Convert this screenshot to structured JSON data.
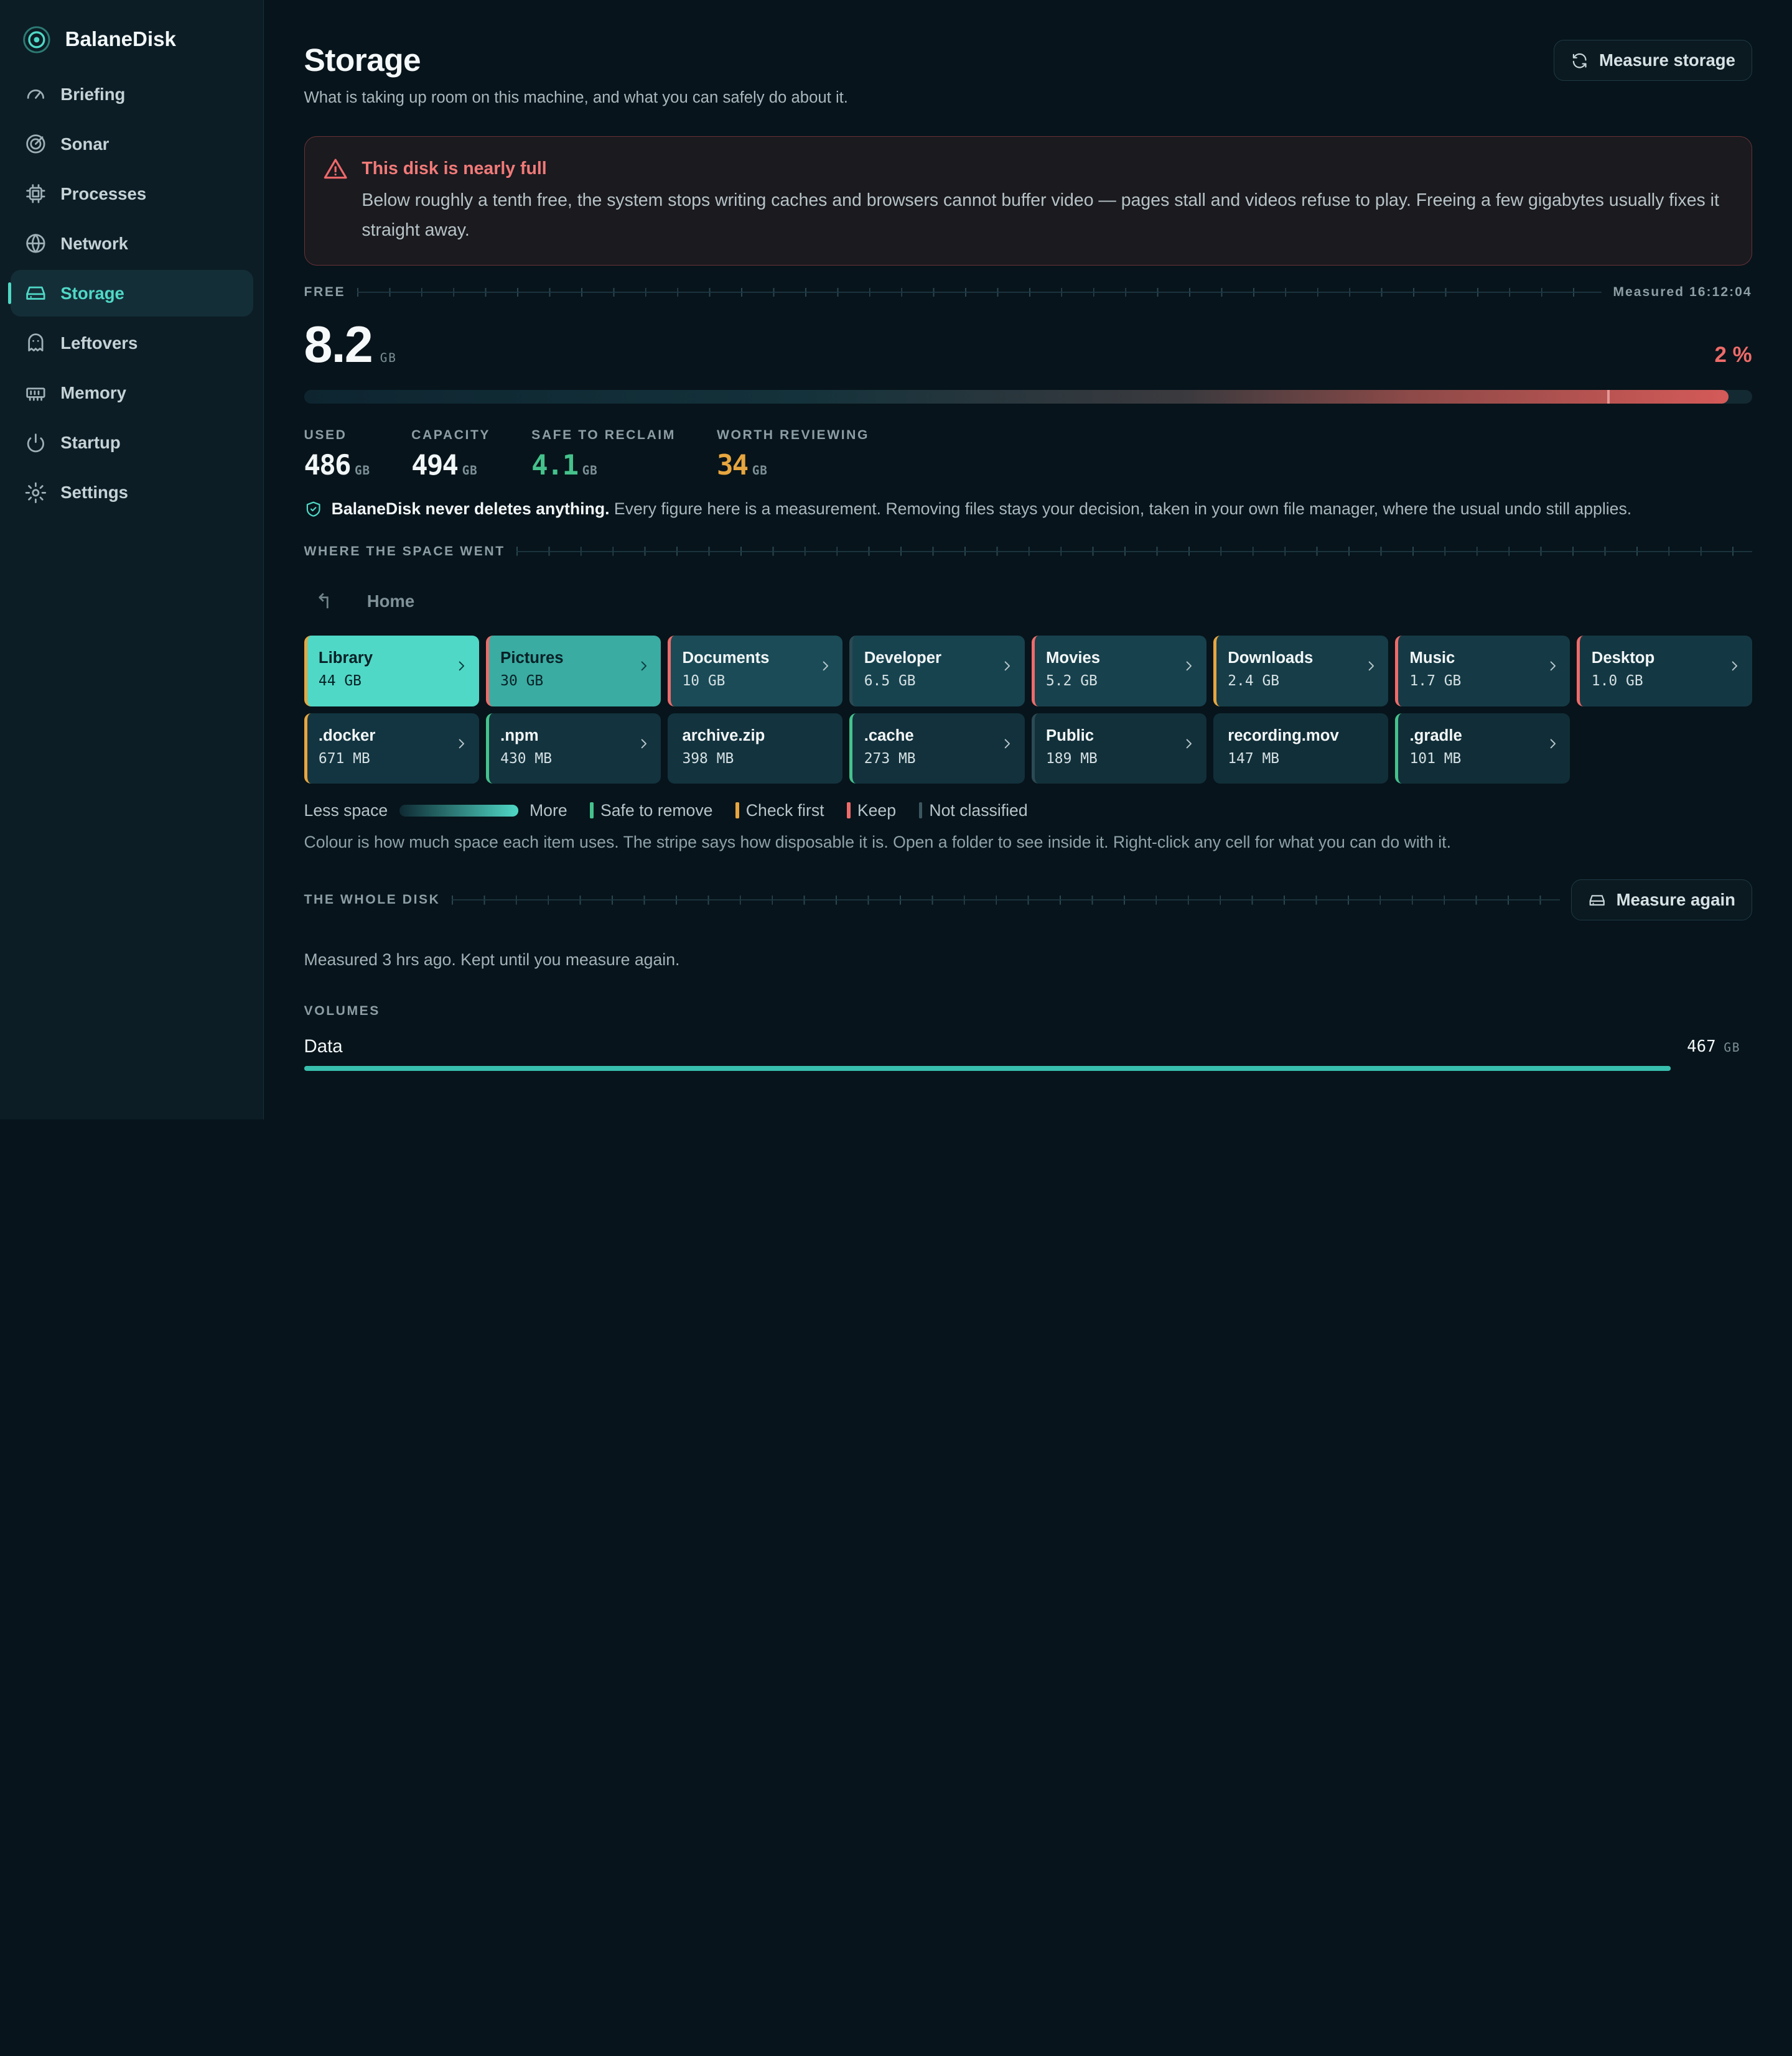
{
  "app": {
    "name": "BalaneDisk"
  },
  "sidebar": {
    "items": [
      {
        "label": "Briefing",
        "icon": "gauge-icon"
      },
      {
        "label": "Sonar",
        "icon": "radar-icon"
      },
      {
        "label": "Processes",
        "icon": "chip-icon"
      },
      {
        "label": "Network",
        "icon": "globe-icon"
      },
      {
        "label": "Storage",
        "icon": "drive-icon",
        "active": true
      },
      {
        "label": "Leftovers",
        "icon": "ghost-icon"
      },
      {
        "label": "Memory",
        "icon": "ram-icon"
      },
      {
        "label": "Startup",
        "icon": "power-icon"
      },
      {
        "label": "Settings",
        "icon": "gear-icon"
      }
    ]
  },
  "page": {
    "title": "Storage",
    "subtitle": "What is taking up room on this machine, and what you can safely do about it.",
    "measure_button": "Measure storage"
  },
  "alert": {
    "title": "This disk is nearly full",
    "body": "Below roughly a tenth free, the system stops writing caches and browsers cannot buffer video — pages stall and videos refuse to play. Freeing a few gigabytes usually fixes it straight away."
  },
  "free": {
    "label": "FREE",
    "measured": "Measured 16:12:04",
    "value": "8.2",
    "unit": "GB",
    "percent_label": "2 %",
    "used_fraction": 0.984,
    "marker_fraction": 0.9
  },
  "stats": [
    {
      "label": "USED",
      "value": "486",
      "unit": "GB",
      "tone": "normal"
    },
    {
      "label": "CAPACITY",
      "value": "494",
      "unit": "GB",
      "tone": "normal"
    },
    {
      "label": "SAFE TO RECLAIM",
      "value": "4.1",
      "unit": "GB",
      "tone": "green"
    },
    {
      "label": "WORTH REVIEWING",
      "value": "34",
      "unit": "GB",
      "tone": "amber"
    }
  ],
  "note": {
    "strong": "BalaneDisk never deletes anything.",
    "text": " Every figure here is a measurement. Removing files stays your decision, taken in your own file manager, where the usual undo still applies."
  },
  "where": {
    "label": "WHERE THE SPACE WENT",
    "up_glyph": "↰",
    "crumb": "Home",
    "cells": [
      {
        "name": "Library",
        "size": "44 GB",
        "fill": "#4fd8c6",
        "stripe": "#e7a63f",
        "folder": true,
        "dark_text": true
      },
      {
        "name": "Pictures",
        "size": "30 GB",
        "fill": "#3aaca2",
        "stripe": "#ef6b69",
        "folder": true,
        "dark_text": true
      },
      {
        "name": "Documents",
        "size": "10 GB",
        "fill": "#1a4b57",
        "stripe": "#ef6b69",
        "folder": true
      },
      {
        "name": "Developer",
        "size": "6.5 GB",
        "fill": "#17434f",
        "stripe": "#2d4a54",
        "folder": true
      },
      {
        "name": "Movies",
        "size": "5.2 GB",
        "fill": "#17414d",
        "stripe": "#ef6b69",
        "folder": true
      },
      {
        "name": "Downloads",
        "size": "2.4 GB",
        "fill": "#163d48",
        "stripe": "#e7a63f",
        "folder": true
      },
      {
        "name": "Music",
        "size": "1.7 GB",
        "fill": "#153a45",
        "stripe": "#ef6b69",
        "folder": true
      },
      {
        "name": "Desktop",
        "size": "1.0 GB",
        "fill": "#143843",
        "stripe": "#ef6b69",
        "folder": true
      },
      {
        "name": ".docker",
        "size": "671 MB",
        "fill": "#133541",
        "stripe": "#e7a63f",
        "folder": true
      },
      {
        "name": ".npm",
        "size": "430 MB",
        "fill": "#13333e",
        "stripe": "#45c28c",
        "folder": true
      },
      {
        "name": "archive.zip",
        "size": "398 MB",
        "fill": "#13333e",
        "stripe": "#13333e",
        "folder": false
      },
      {
        "name": ".cache",
        "size": "273 MB",
        "fill": "#12313c",
        "stripe": "#45c28c",
        "folder": true
      },
      {
        "name": "Public",
        "size": "189 MB",
        "fill": "#12303a",
        "stripe": "#2d4a54",
        "folder": true
      },
      {
        "name": "recording.mov",
        "size": "147 MB",
        "fill": "#112f39",
        "stripe": "#112f39",
        "folder": false
      },
      {
        "name": ".gradle",
        "size": "101 MB",
        "fill": "#112e38",
        "stripe": "#45c28c",
        "folder": true
      }
    ]
  },
  "legend": {
    "less": "Less space",
    "more": "More",
    "items": [
      {
        "label": "Safe to remove",
        "color": "#45c28c"
      },
      {
        "label": "Check first",
        "color": "#e7a63f"
      },
      {
        "label": "Keep",
        "color": "#ef6b69"
      },
      {
        "label": "Not classified",
        "color": "#3c5660"
      }
    ],
    "note": "Colour is how much space each item uses. The stripe says how disposable it is. Open a folder to see inside it. Right-click any cell for what you can do with it."
  },
  "whole": {
    "label": "THE WHOLE DISK",
    "button": "Measure again",
    "measured_ago": "Measured 3 hrs ago. Kept until you measure again.",
    "volumes_label": "VOLUMES",
    "volume": {
      "name": "Data",
      "size": "467",
      "unit": "GB"
    }
  }
}
